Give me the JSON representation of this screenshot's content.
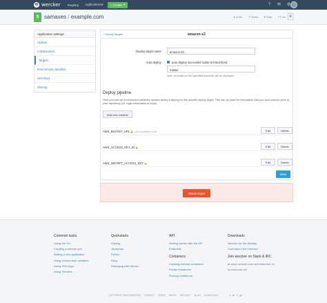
{
  "nav": {
    "brand": "wercker",
    "registry": "Registry",
    "applications": "Applications",
    "create": "+ Create",
    "create_caret": "▾"
  },
  "header": {
    "badge": "S",
    "owner": "samaxes",
    "sep": " / ",
    "app": "example.com",
    "actions": [
      {
        "icon": "●",
        "label": "Invite"
      },
      {
        "icon": "↗",
        "label": "Share"
      },
      {
        "icon": "♥",
        "label": "Starr"
      },
      {
        "icon": "⑂",
        "label": "Fork"
      }
    ],
    "gear": "⚙"
  },
  "sidebar": {
    "heading": "Application settings",
    "items": [
      {
        "label": "Options"
      },
      {
        "label": "Collaborators"
      },
      {
        "label": "Targets"
      },
      {
        "label": "Environment variables"
      },
      {
        "label": "SSH keys"
      },
      {
        "label": "Sharing"
      }
    ]
  },
  "target": {
    "back": "‹ Deploy targets",
    "name": "amazon-s3",
    "name_label": "Deploy target name :",
    "name_value": "amazon-s3",
    "autodeploy_label": "Auto deploy :",
    "autodeploy_text": "auto deploy successful builds to branch(es):",
    "branch_value": "master",
    "note": "note: all builds on the specified branches will be deployed"
  },
  "pipeline": {
    "title": "Deploy pipeline",
    "desc": "Here you can set environment variables needed during a deploy for this specific deploy target. This can be used for information that you don't want to store in your repository (i.e. login information or keys)",
    "add_button": "Add new variable",
    "vars": [
      {
        "key": "AWS_BUCKET_URL",
        "value": "s3://example.com"
      },
      {
        "key": "AWS_ACCESS_KEY_ID",
        "value": ""
      },
      {
        "key": "AWS_SECRET_ACCESS_KEY",
        "value": ""
      }
    ],
    "edit_label": "Edit",
    "delete_label": "Delete",
    "lock_icon": "🔒",
    "save": "Save"
  },
  "danger": {
    "delete_target": "Delete target"
  },
  "footer": {
    "common": {
      "title": "Common tasks",
      "links": [
        "Using the CLI",
        "Creating a wercker.yml",
        "Adding a new application",
        "Using environment variables",
        "Using SSH keys",
        "Using Services"
      ]
    },
    "quickstarts": {
      "title": "Quickstarts",
      "links": [
        "Golang",
        "Javascript",
        "Python",
        "Ruby",
        "Deploying with Heroku"
      ]
    },
    "api": {
      "title": "API",
      "links": [
        "Getting started with the API",
        "Endpoints"
      ],
      "containers_title": "Containers",
      "containers_links": [
        "Creating minimal containers",
        "Private containers",
        "Pushing containers"
      ]
    },
    "downloads": {
      "title": "Downloads",
      "links": [
        "Wercker for the desktop",
        "Command Line Interface"
      ],
      "irc_title": "Join wercker on Slack & IRC",
      "irc_links": [
        "at slack.wercker.com and #wercker on",
        "irc.freenode.net"
      ]
    },
    "bar": [
      "COPYRIGHT ©2015 WERCKER",
      "CONTACT",
      "TERMS",
      "ABOUT",
      "SECURITY",
      "BLOG",
      "DOWNLOADS"
    ],
    "social": [
      "t",
      "in",
      "f",
      "g+"
    ]
  }
}
